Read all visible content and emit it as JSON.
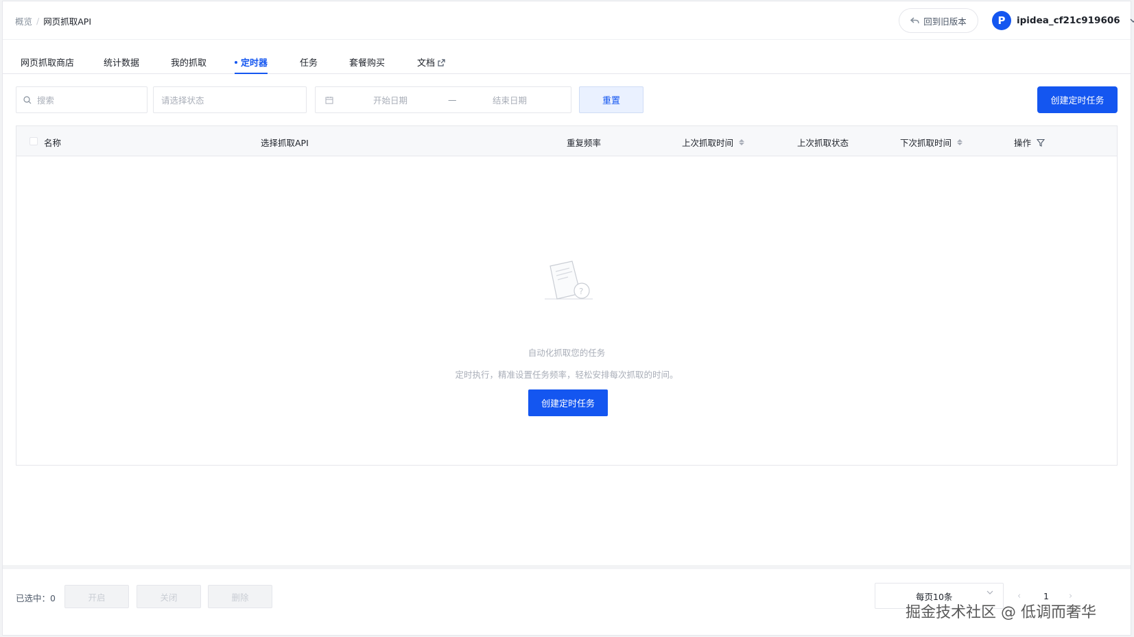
{
  "breadcrumb": {
    "parent": "概览",
    "separator": "/",
    "current": "网页抓取API"
  },
  "header": {
    "old_version_label": "回到旧版本",
    "username": "ipidea_cf21c919606",
    "avatar_letter": "P"
  },
  "tabs": [
    {
      "label": "网页抓取商店"
    },
    {
      "label": "统计数据"
    },
    {
      "label": "我的抓取"
    },
    {
      "label": "定时器",
      "active": true
    },
    {
      "label": "任务"
    },
    {
      "label": "套餐购买"
    },
    {
      "label": "文档",
      "external": true
    }
  ],
  "filters": {
    "search_placeholder": "搜索",
    "status_placeholder": "请选择状态",
    "start_date_placeholder": "开始日期",
    "date_separator": "—",
    "end_date_placeholder": "结束日期",
    "reset_label": "重置",
    "create_label": "创建定时任务"
  },
  "table": {
    "columns": [
      "名称",
      "选择抓取API",
      "重复频率",
      "上次抓取时间",
      "上次抓取状态",
      "下次抓取时间",
      "操作"
    ],
    "empty_title": "自动化抓取您的任务",
    "empty_desc": "定时执行，精准设置任务频率，轻松安排每次抓取的时间。",
    "empty_create_label": "创建定时任务"
  },
  "footer": {
    "selected_label": "已选中：",
    "selected_count": "0",
    "enable_label": "开启",
    "disable_label": "关闭",
    "delete_label": "删除",
    "page_size_label": "每页10条",
    "current_page": "1",
    "prev_symbol": "‹",
    "next_symbol": "›"
  },
  "watermark": "掘金技术社区 @ 低调而奢华",
  "colors": {
    "primary": "#1456f0",
    "muted_text": "#a9aeb8",
    "border": "#e5e6eb"
  }
}
